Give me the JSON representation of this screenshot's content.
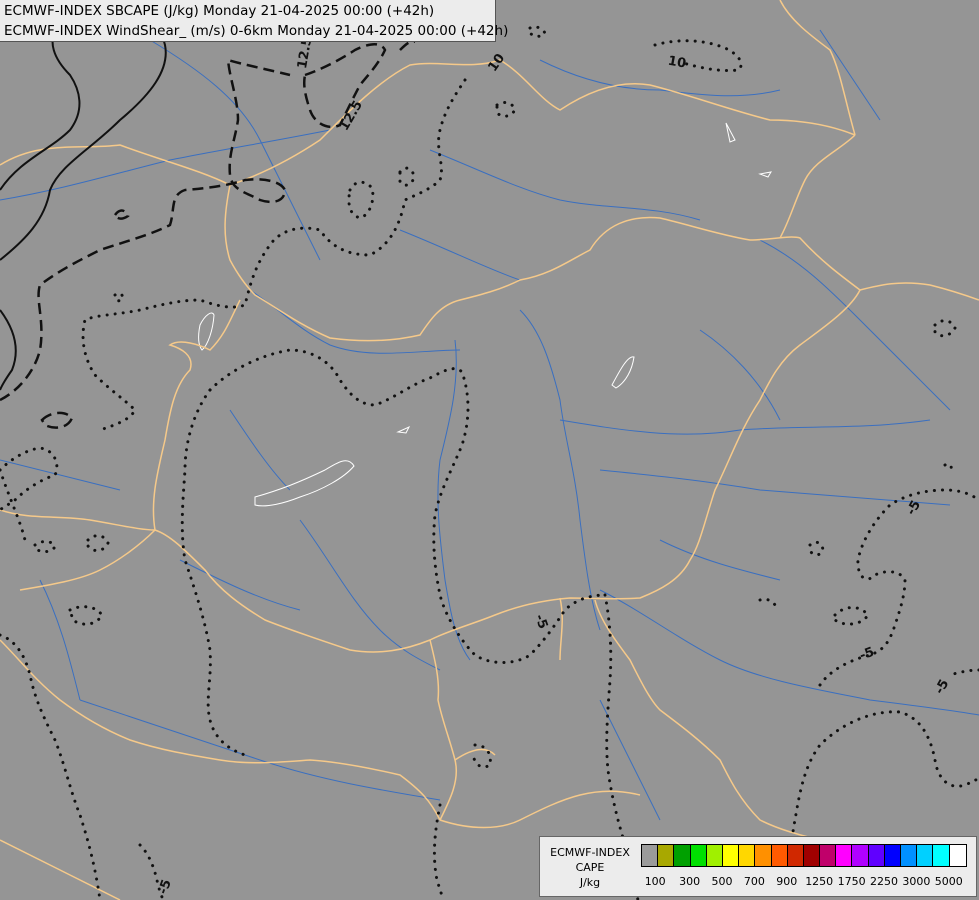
{
  "header": {
    "line1": "ECMWF-INDEX SBCAPE (J/kg) Monday 21-04-2025 00:00 (+42h)",
    "line2": "ECMWF-INDEX WindShear_ (m/s) 0-6km Monday 21-04-2025 00:00 (+42h)"
  },
  "legend": {
    "line1": "ECMWF-INDEX",
    "line2": "CAPE",
    "line3": "J/kg",
    "colors": [
      "#9b9b9b",
      "#a8a800",
      "#00a000",
      "#00e000",
      "#a0f000",
      "#ffff00",
      "#ffd700",
      "#ff9000",
      "#ff5a00",
      "#d02800",
      "#a00000",
      "#c0006a",
      "#ff00ff",
      "#b000ff",
      "#6000ff",
      "#0000ff",
      "#0090ff",
      "#00d0ff",
      "#00ffff",
      "#ffffff"
    ],
    "tick_labels": [
      "100",
      "300",
      "500",
      "700",
      "900",
      "1250",
      "1750",
      "2250",
      "3000",
      "5000"
    ]
  },
  "contour_labels": [
    "12.5",
    "12.5",
    "10",
    "10",
    "-5",
    "-5",
    "-5",
    "-5",
    "-5"
  ],
  "colors": {
    "background": "#959595",
    "borders": "#f5c98a",
    "rivers": "#3a6fc0",
    "contours": "#111111"
  }
}
